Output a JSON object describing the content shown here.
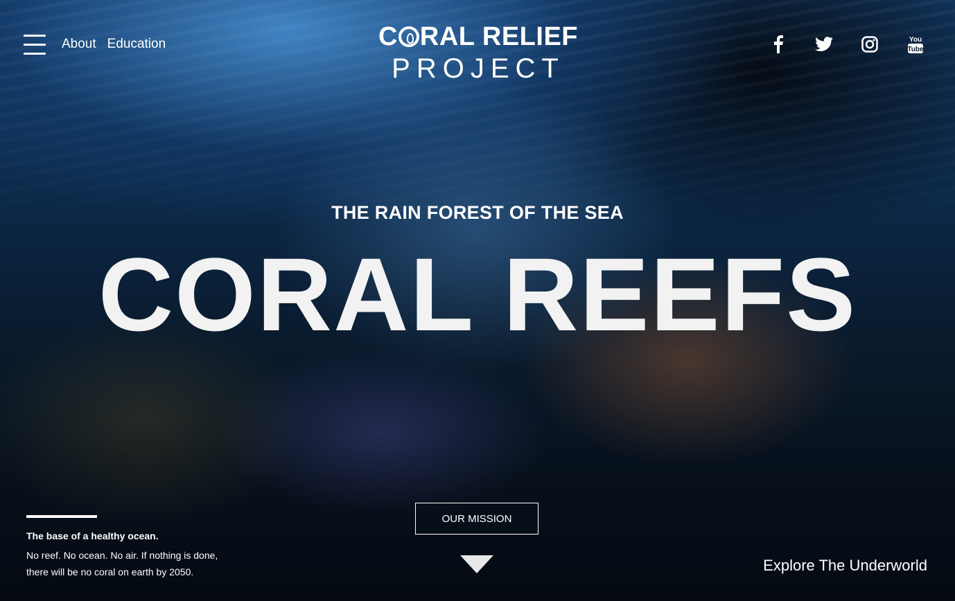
{
  "header": {
    "menu_icon": "hamburger-icon",
    "nav": [
      "About",
      "Education"
    ],
    "logo": {
      "line1_a": "C",
      "line1_b": "RAL RELIEF",
      "line2": "PROJECT"
    },
    "social": [
      "facebook-icon",
      "twitter-icon",
      "instagram-icon",
      "youtube-icon"
    ],
    "youtube_text": {
      "top": "You",
      "bottom": "Tube"
    }
  },
  "hero": {
    "tagline": "THE RAIN FOREST OF THE SEA",
    "headline": "CORAL REEFS",
    "cta_label": "OUR MISSION",
    "down_icon": "chevron-down-icon"
  },
  "footer_left": {
    "title": "The base of a healthy ocean.",
    "body": "No reef. No ocean. No air. If nothing is done, there will be no coral on earth by 2050."
  },
  "footer_right": {
    "link": "Explore The Underworld"
  },
  "colors": {
    "text": "#ffffff",
    "ocean_dark": "#07101b",
    "ocean_light": "#123a66"
  }
}
